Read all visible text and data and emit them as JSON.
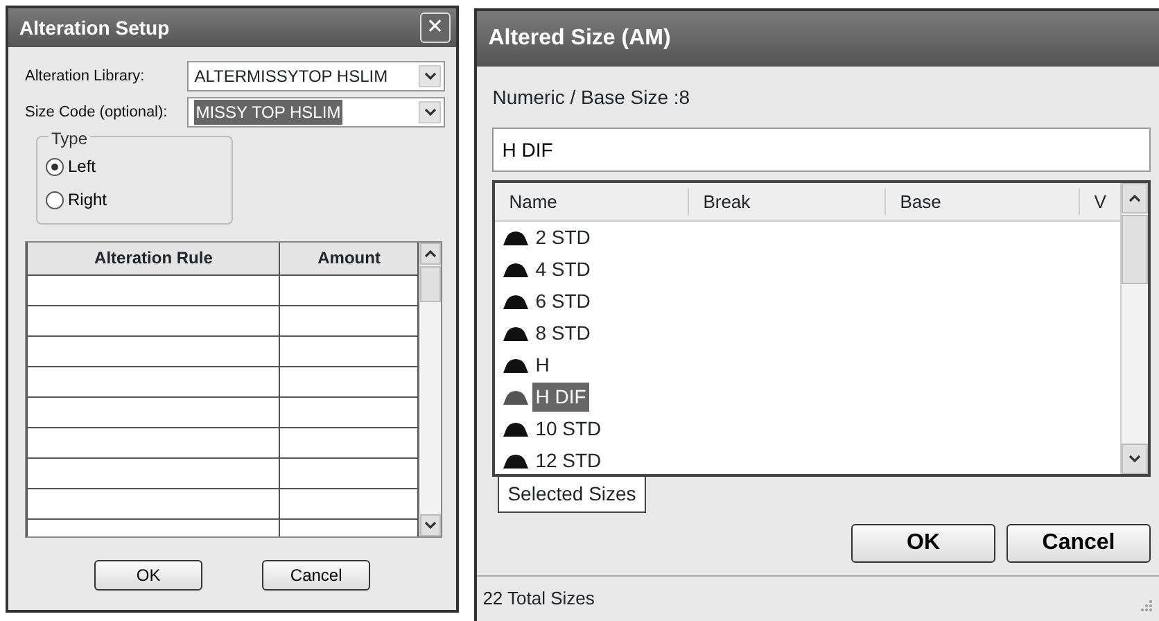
{
  "alteration_setup": {
    "title": "Alteration Setup",
    "close": "✕",
    "fields": [
      {
        "label": "Alteration Library:",
        "value": "ALTERMISSYTOP HSLIM",
        "highlighted": false
      },
      {
        "label": "Size Code (optional):",
        "value": "MISSY TOP HSLIM",
        "highlighted": true
      }
    ],
    "type_group": {
      "legend": "Type",
      "options": [
        {
          "label": "Left",
          "selected": true
        },
        {
          "label": "Right",
          "selected": false
        }
      ]
    },
    "table": {
      "columns": [
        "Alteration Rule",
        "Amount"
      ]
    },
    "buttons": [
      "OK",
      "Cancel"
    ]
  },
  "altered_size": {
    "title": "Altered Size (AM)",
    "base_size": "Numeric / Base Size :8",
    "search": {
      "value": "H DIF"
    },
    "list": {
      "columns": [
        "Name",
        "Break",
        "Base",
        "V"
      ],
      "rows": [
        {
          "name": "2 STD",
          "selected": false
        },
        {
          "name": "4 STD",
          "selected": false
        },
        {
          "name": "6 STD",
          "selected": false
        },
        {
          "name": "8 STD",
          "selected": false
        },
        {
          "name": "H",
          "selected": false
        },
        {
          "name": "H DIF",
          "selected": true
        },
        {
          "name": "10 STD",
          "selected": false
        },
        {
          "name": "12 STD",
          "selected": false
        }
      ]
    },
    "tab": "Selected Sizes",
    "buttons": [
      "OK",
      "Cancel"
    ],
    "status_bar": "22 Total Sizes"
  }
}
